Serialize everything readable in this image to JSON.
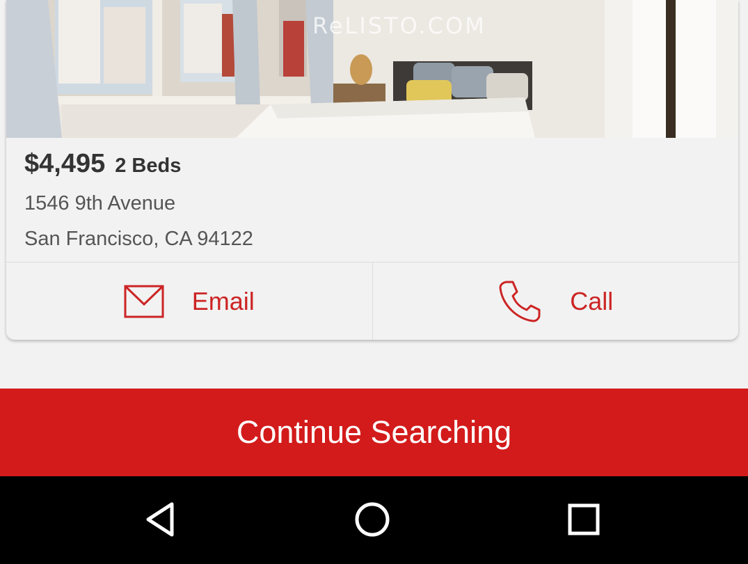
{
  "listing": {
    "watermark": "ReLISTO.COM",
    "price": "$4,495",
    "beds": "2 Beds",
    "address_line1": "1546 9th Avenue",
    "address_line2": "San Francisco, CA 94122"
  },
  "actions": {
    "email_label": "Email",
    "call_label": "Call"
  },
  "cta": {
    "label": "Continue Searching"
  },
  "icons": {
    "email": "envelope-icon",
    "call": "phone-icon",
    "back": "back-triangle-icon",
    "home": "home-circle-icon",
    "recents": "recents-square-icon"
  },
  "colors": {
    "accent": "#d31b1b",
    "action_text": "#cc2424",
    "card_bg": "#f2f2f2",
    "navbar_bg": "#000000"
  }
}
